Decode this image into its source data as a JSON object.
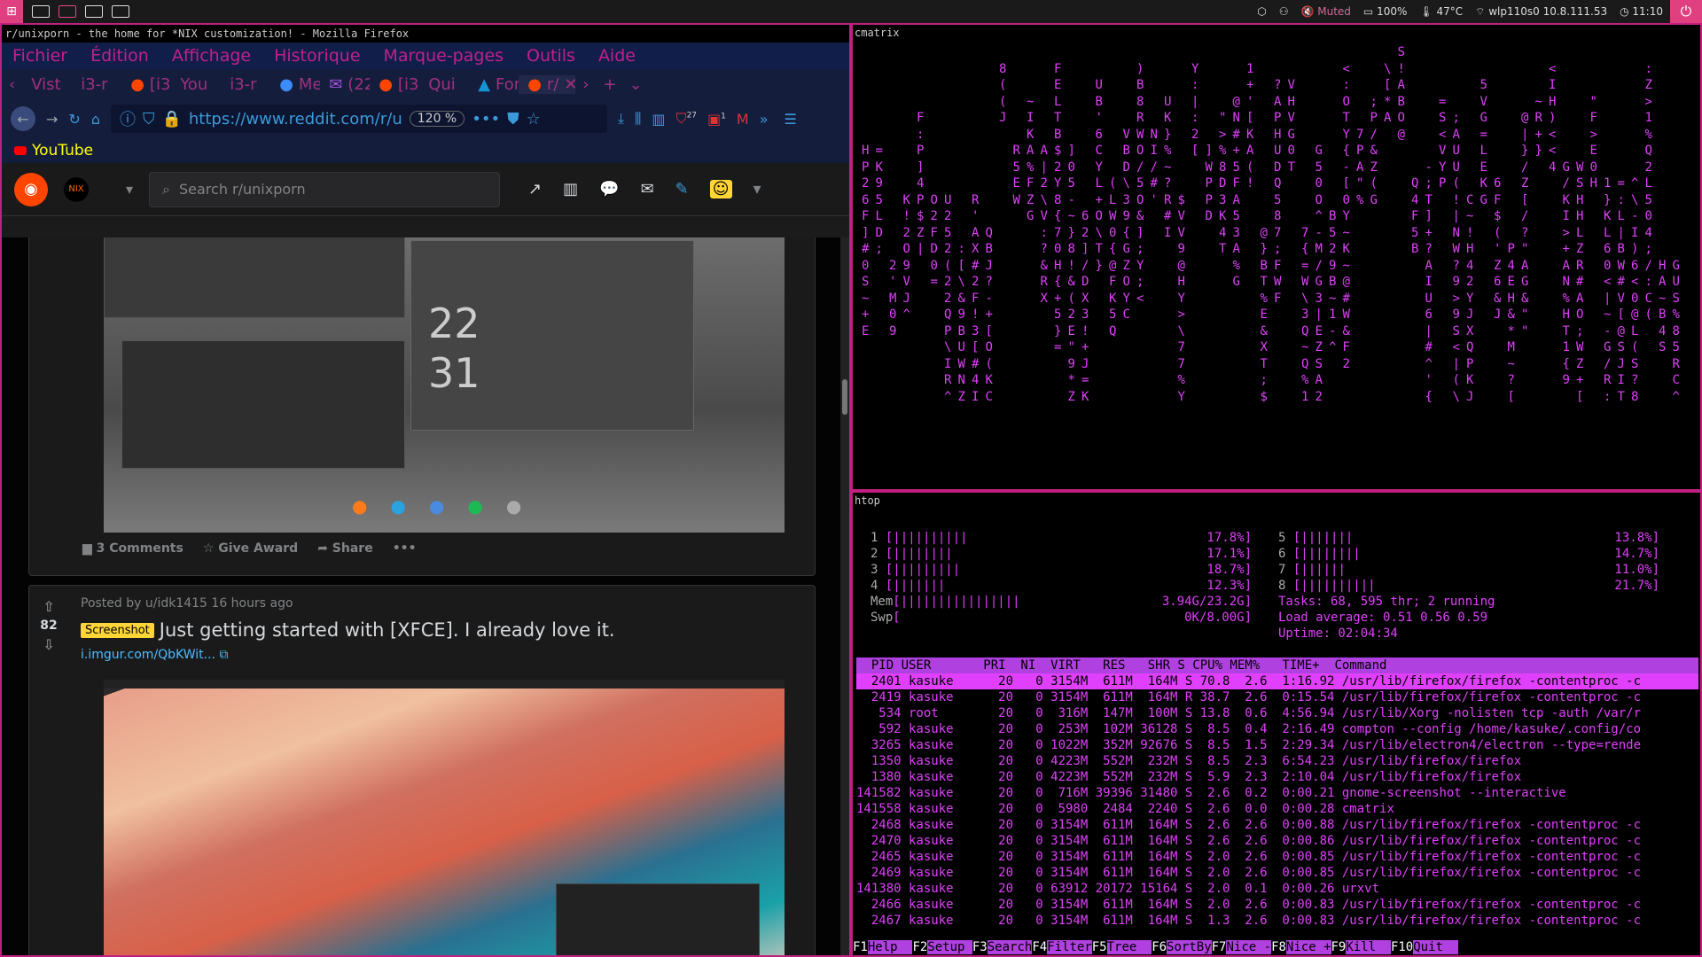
{
  "topbar": {
    "wifi": "wlp110s0 10.8.111.53",
    "muted": "Muted",
    "battery": "100%",
    "temp": "47°C",
    "clock": "11:10"
  },
  "firefox": {
    "window_title": "r/unixporn - the home for *NIX customization! - Mozilla Firefox",
    "menu": [
      "Fichier",
      "Édition",
      "Affichage",
      "Historique",
      "Marque-pages",
      "Outils",
      "Aide"
    ],
    "tabs": [
      "Vist",
      "i3-r",
      "[i3-c",
      "You",
      "i3-r",
      "Me",
      "(22",
      "[i3-c",
      "Qui",
      "For",
      "r/"
    ],
    "url": "https://www.reddit.com/r/u",
    "zoom": "120 %",
    "badge1": "27",
    "badge2": "1",
    "bookmark": "YouTube"
  },
  "reddit": {
    "search_placeholder": "Search r/unixporn",
    "post1": {
      "comments": "3 Comments",
      "award": "Give Award",
      "share": "Share",
      "more": "•••",
      "clock1": "22",
      "clock2": "31"
    },
    "post2": {
      "meta": "Posted by u/idk1415 16 hours ago",
      "votes": "82",
      "flair": "Screenshot",
      "title": "Just getting started with [XFCE]. I already love it.",
      "link": "i.imgur.com/QbKWit..."
    }
  },
  "cmatrix": {
    "title": "cmatrix"
  },
  "htop": {
    "title": "htop",
    "cpu": [
      {
        "n": "1",
        "pct": "17.8%"
      },
      {
        "n": "2",
        "pct": "17.1%"
      },
      {
        "n": "3",
        "pct": "18.7%"
      },
      {
        "n": "4",
        "pct": "12.3%"
      },
      {
        "n": "5",
        "pct": "13.8%"
      },
      {
        "n": "6",
        "pct": "14.7%"
      },
      {
        "n": "7",
        "pct": "11.0%"
      },
      {
        "n": "8",
        "pct": "21.7%"
      }
    ],
    "mem": "3.94G/23.2G",
    "swp": "0K/8.00G",
    "tasks": "Tasks: 68, 595 thr; 2 running",
    "load": "Load average: 0.51 0.56 0.59",
    "uptime": "Uptime: 02:04:34",
    "header": "  PID USER       PRI  NI  VIRT   RES   SHR S CPU% MEM%   TIME+  Command",
    "rows": [
      "  2401 kasuke      20   0 3154M  611M  164M S 70.8  2.6  1:16.92 /usr/lib/firefox/firefox -contentproc -c",
      "  2419 kasuke      20   0 3154M  611M  164M R 38.7  2.6  0:15.54 /usr/lib/firefox/firefox -contentproc -c",
      "   534 root        20   0  316M  147M  100M S 13.8  0.6  4:56.94 /usr/lib/Xorg -nolisten tcp -auth /var/r",
      "   592 kasuke      20   0  253M  102M 36128 S  8.5  0.4  2:16.49 compton --config /home/kasuke/.config/co",
      "  3265 kasuke      20   0 1022M  352M 92676 S  8.5  1.5  2:29.34 /usr/lib/electron4/electron --type=rende",
      "  1350 kasuke      20   0 4223M  552M  232M S  8.5  2.3  6:54.23 /usr/lib/firefox/firefox",
      "  1380 kasuke      20   0 4223M  552M  232M S  5.9  2.3  2:10.04 /usr/lib/firefox/firefox",
      "141582 kasuke      20   0  716M 39396 31480 S  2.6  0.2  0:00.21 gnome-screenshot --interactive",
      "141558 kasuke      20   0  5980  2484  2240 S  2.6  0.0  0:00.28 cmatrix",
      "  2468 kasuke      20   0 3154M  611M  164M S  2.6  2.6  0:00.88 /usr/lib/firefox/firefox -contentproc -c",
      "  2470 kasuke      20   0 3154M  611M  164M S  2.6  2.6  0:00.86 /usr/lib/firefox/firefox -contentproc -c",
      "  2465 kasuke      20   0 3154M  611M  164M S  2.0  2.6  0:00.85 /usr/lib/firefox/firefox -contentproc -c",
      "  2469 kasuke      20   0 3154M  611M  164M S  2.0  2.6  0:00.85 /usr/lib/firefox/firefox -contentproc -c",
      "141380 kasuke      20   0 63912 20172 15164 S  2.0  0.1  0:00.26 urxvt",
      "  2466 kasuke      20   0 3154M  611M  164M S  2.0  2.6  0:00.83 /usr/lib/firefox/firefox -contentproc -c",
      "  2467 kasuke      20   0 3154M  611M  164M S  1.3  2.6  0:00.83 /usr/lib/firefox/firefox -contentproc -c"
    ],
    "fkeys": [
      {
        "k": "F1",
        "l": "Help  "
      },
      {
        "k": "F2",
        "l": "Setup "
      },
      {
        "k": "F3",
        "l": "Search"
      },
      {
        "k": "F4",
        "l": "Filter"
      },
      {
        "k": "F5",
        "l": "Tree  "
      },
      {
        "k": "F6",
        "l": "SortBy"
      },
      {
        "k": "F7",
        "l": "Nice -"
      },
      {
        "k": "F8",
        "l": "Nice +"
      },
      {
        "k": "F9",
        "l": "Kill  "
      },
      {
        "k": "F10",
        "l": "Quit  "
      }
    ]
  }
}
